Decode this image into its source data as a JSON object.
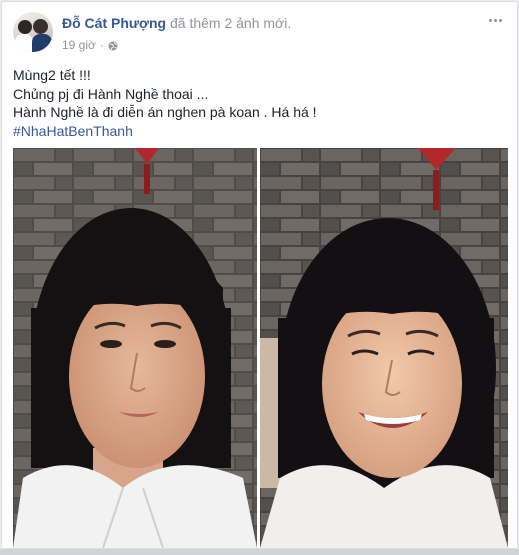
{
  "post": {
    "author": "Đỗ Cát Phượng",
    "action_text": "đã thêm 2 ảnh mới.",
    "timestamp": "19 giờ",
    "separator": "·",
    "privacy_icon": "globe-icon",
    "more_icon": "more-options-icon",
    "lines": [
      "Mùng2 tết !!!",
      "Chủng pj đi Hành Nghề thoai ...",
      "Hành Nghề là đi diễn án nghen pà koan . Há há !"
    ],
    "hashtag": "#NhaHatBenThanh"
  },
  "colors": {
    "link_blue": "#365899",
    "meta_gray": "#90949c",
    "text_dark": "#1d2129",
    "card_bg": "#ffffff",
    "page_bg": "#e9ebee"
  }
}
